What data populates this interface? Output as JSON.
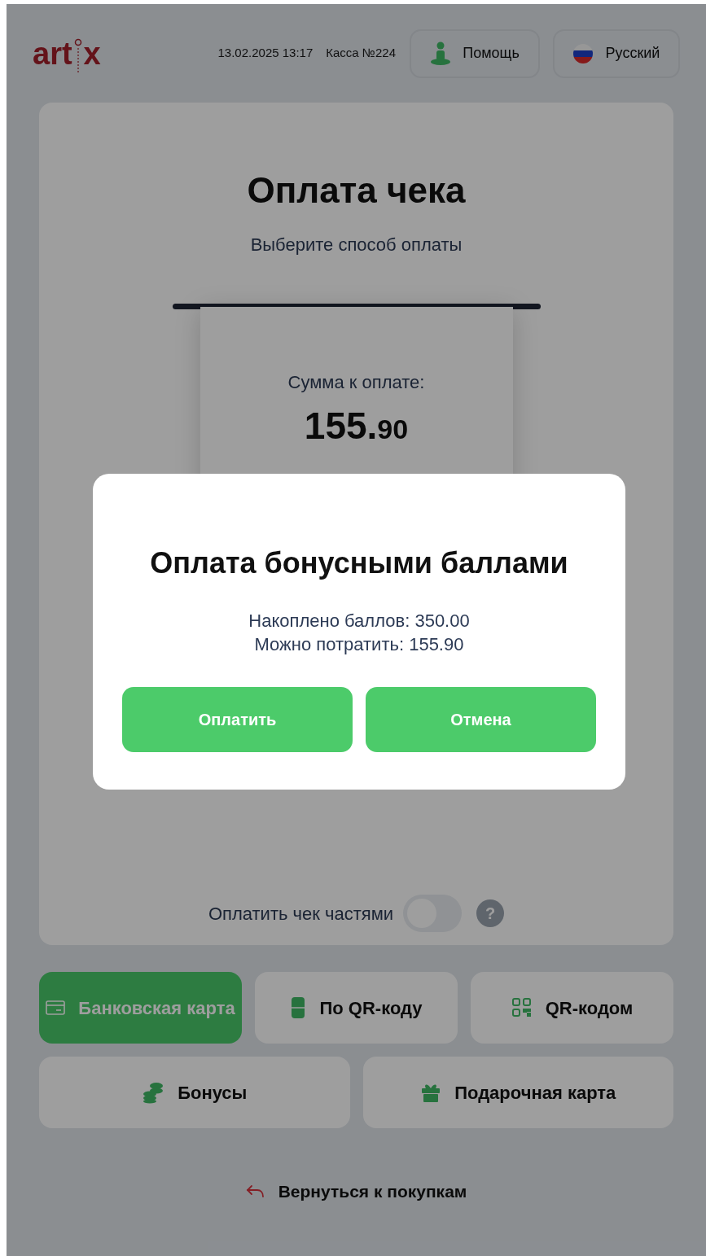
{
  "header": {
    "logo": {
      "left": "art",
      "right": "x"
    },
    "datetime": "13.02.2025 13:17",
    "register": "Касса №224",
    "help_button": "Помощь",
    "language_button": "Русский"
  },
  "payment": {
    "title": "Оплата чека",
    "subtitle": "Выберите способ оплаты",
    "receipt": {
      "label": "Сумма к оплате:",
      "amount_main": "155.",
      "amount_cents": "90"
    },
    "split": {
      "label": "Оплатить чек частями",
      "on": false,
      "help": "?"
    }
  },
  "methods": [
    {
      "label": "Банковская карта",
      "kind": "card",
      "selected": true
    },
    {
      "label": "По QR-коду",
      "kind": "phone",
      "selected": false
    },
    {
      "label": "QR-кодом",
      "kind": "qr",
      "selected": false
    },
    {
      "label": "Бонусы",
      "kind": "coins",
      "selected": false
    },
    {
      "label": "Подарочная карта",
      "kind": "gift",
      "selected": false
    }
  ],
  "back_link": "Вернуться к покупкам",
  "dialog": {
    "title": "Оплата бонусными баллами",
    "lines": [
      "Накоплено баллов: 350.00",
      "Можно потратить: 155.90"
    ],
    "buttons": [
      "Оплатить",
      "Отмена"
    ]
  }
}
